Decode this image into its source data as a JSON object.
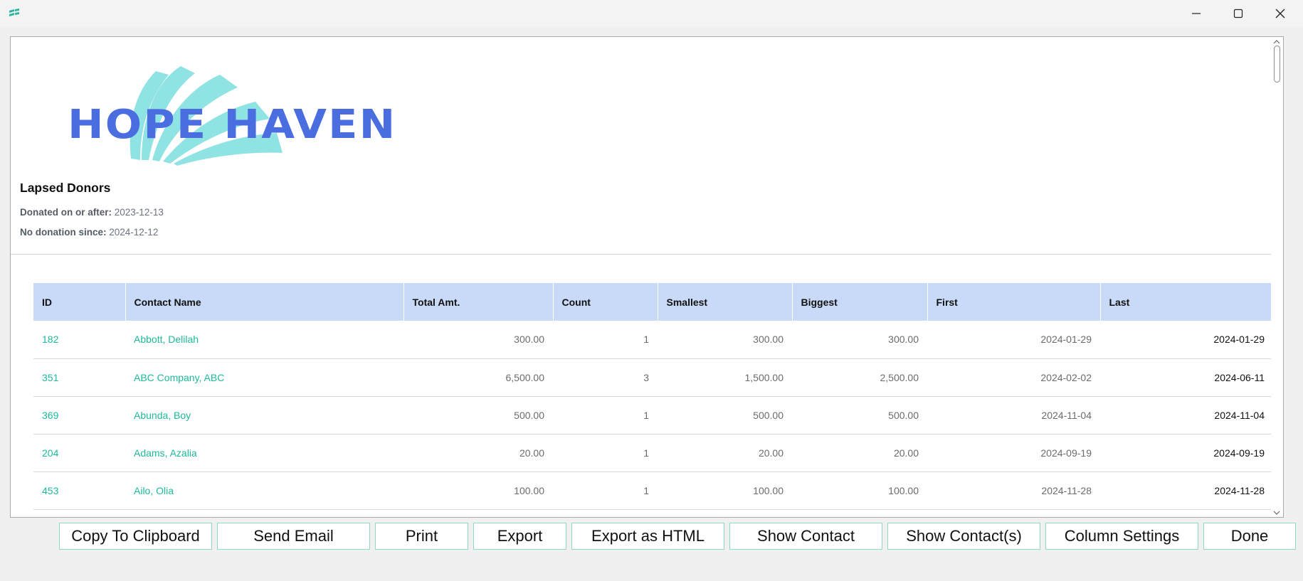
{
  "window": {
    "app_icon": "app-logo-icon",
    "controls": [
      "minimize-icon",
      "maximize-icon",
      "close-icon"
    ]
  },
  "report": {
    "logo_text": "HOPE HAVEN",
    "title": "Lapsed Donors",
    "filters": [
      {
        "label": "Donated on or after:",
        "value": "2023-12-13"
      },
      {
        "label": "No donation since:",
        "value": "2024-12-12"
      }
    ]
  },
  "table": {
    "columns": [
      "ID",
      "Contact Name",
      "Total Amt.",
      "Count",
      "Smallest",
      "Biggest",
      "First",
      "Last"
    ],
    "rows": [
      {
        "id": "182",
        "name": "Abbott, Delilah",
        "total": "300.00",
        "count": "1",
        "smallest": "300.00",
        "biggest": "300.00",
        "first": "2024-01-29",
        "last": "2024-01-29"
      },
      {
        "id": "351",
        "name": "ABC Company, ABC",
        "total": "6,500.00",
        "count": "3",
        "smallest": "1,500.00",
        "biggest": "2,500.00",
        "first": "2024-02-02",
        "last": "2024-06-11"
      },
      {
        "id": "369",
        "name": "Abunda, Boy",
        "total": "500.00",
        "count": "1",
        "smallest": "500.00",
        "biggest": "500.00",
        "first": "2024-11-04",
        "last": "2024-11-04"
      },
      {
        "id": "204",
        "name": "Adams, Azalia",
        "total": "20.00",
        "count": "1",
        "smallest": "20.00",
        "biggest": "20.00",
        "first": "2024-09-19",
        "last": "2024-09-19"
      },
      {
        "id": "453",
        "name": "Ailo, Olia",
        "total": "100.00",
        "count": "1",
        "smallest": "100.00",
        "biggest": "100.00",
        "first": "2024-11-28",
        "last": "2024-11-28"
      }
    ]
  },
  "buttons": {
    "copy": "Copy To Clipboard",
    "email": "Send Email",
    "print": "Print",
    "export": "Export",
    "export_html": "Export as HTML",
    "show_contact": "Show Contact",
    "show_contacts": "Show Contact(s)",
    "column_settings": "Column Settings",
    "done": "Done"
  },
  "colors": {
    "accent": "#1fb99b",
    "header_bg": "#c9daf8",
    "logo_blue": "#4a6ee0",
    "logo_cyan": "#8fe3e3",
    "button_border": "#8fd9c9"
  }
}
